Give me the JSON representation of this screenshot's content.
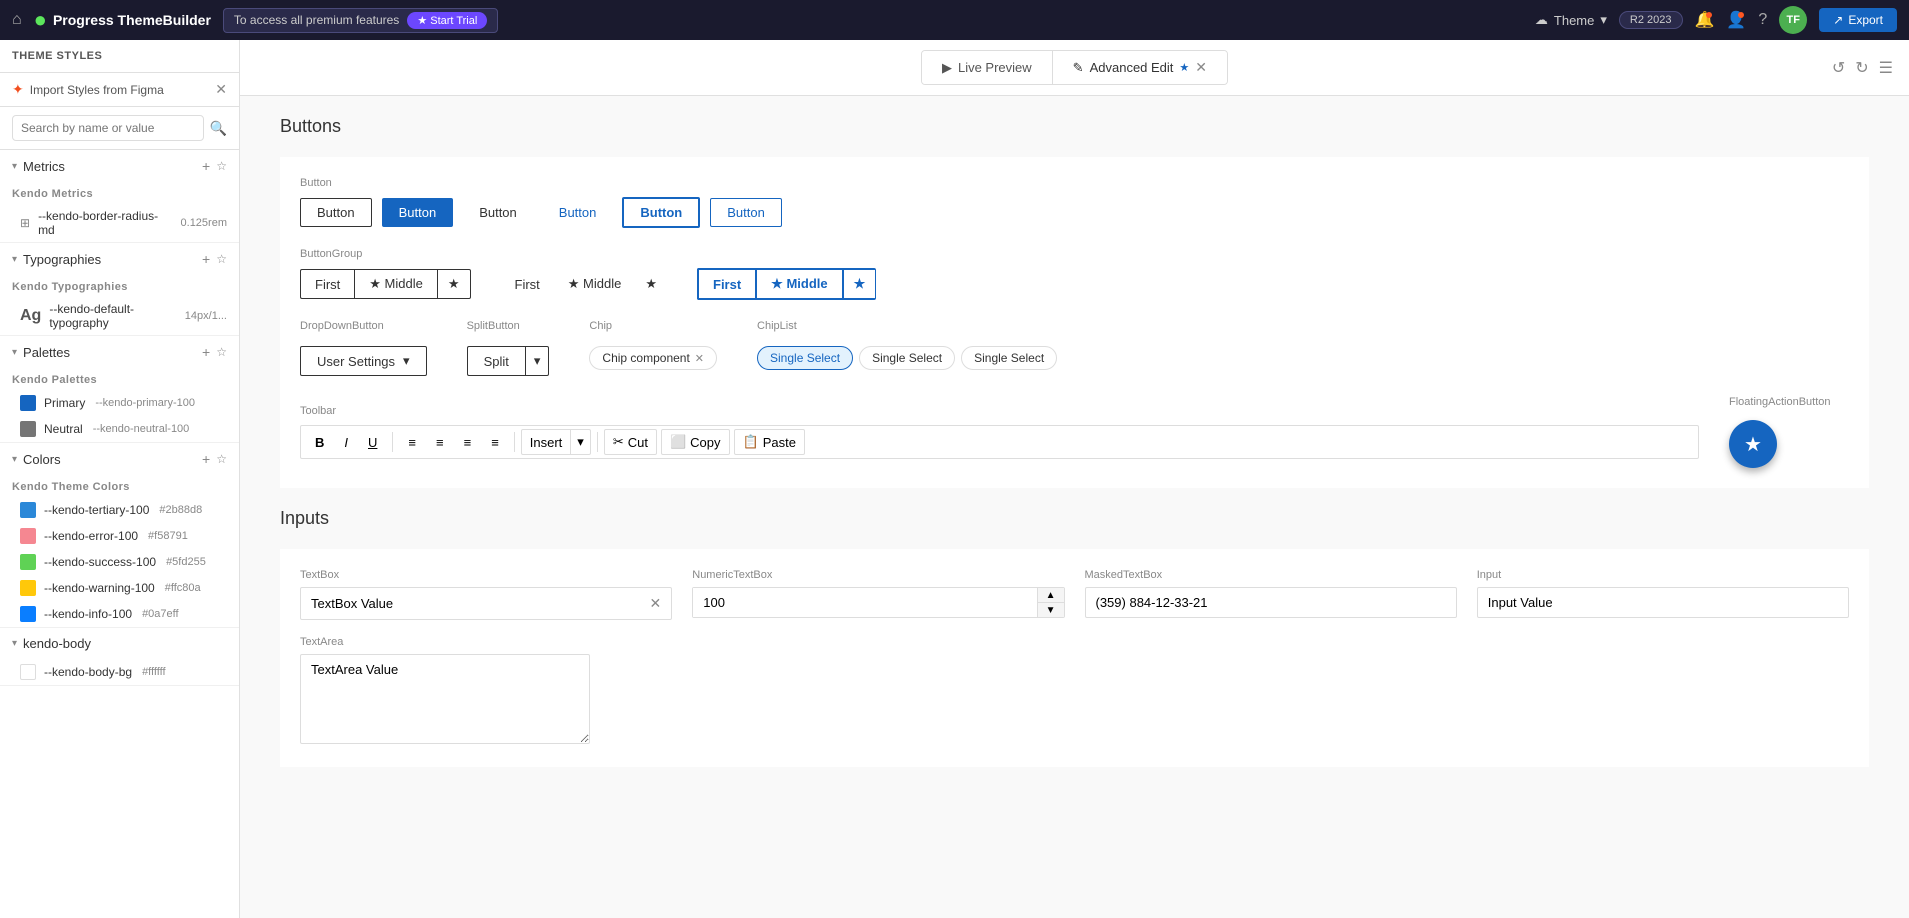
{
  "topnav": {
    "logo_text": "Progress ThemeBuilder",
    "trial_message": "To access all premium features",
    "trial_btn": "★ Start Trial",
    "theme_label": "Theme",
    "version": "R2 2023",
    "export_btn": "Export"
  },
  "toolbar_tabs": {
    "live_preview": "Live Preview",
    "advanced_edit": "Advanced Edit",
    "active": "advanced_edit"
  },
  "sidebar": {
    "header": "THEME STYLES",
    "figma_import": "Import Styles from Figma",
    "search_placeholder": "Search by name or value",
    "sections": [
      {
        "id": "metrics",
        "label": "Metrics",
        "kendo_label": "Kendo Metrics",
        "items": [
          {
            "name": "--kendo-border-radius-md",
            "value": "0.125rem"
          }
        ]
      },
      {
        "id": "typographies",
        "label": "Typographies",
        "kendo_label": "Kendo Typographies",
        "items": [
          {
            "name": "--kendo-default-typography",
            "value": "14px/1..."
          }
        ]
      },
      {
        "id": "palettes",
        "label": "Palettes",
        "kendo_label": "Kendo Palettes",
        "items": [
          {
            "name": "Primary",
            "var": "--kendo-primary-100",
            "color": "#1565C0"
          },
          {
            "name": "Neutral",
            "var": "--kendo-neutral-100",
            "color": "#757575"
          }
        ]
      },
      {
        "id": "colors",
        "label": "Colors",
        "kendo_label": "Kendo Theme Colors",
        "items": [
          {
            "name": "--kendo-tertiary-100",
            "value": "#2b88d8",
            "color": "#2b88d8"
          },
          {
            "name": "--kendo-error-100",
            "value": "#f58791",
            "color": "#f58791"
          },
          {
            "name": "--kendo-success-100",
            "value": "#5fd255",
            "color": "#5fd255"
          },
          {
            "name": "--kendo-warning-100",
            "value": "#ffc80a",
            "color": "#ffc80a"
          },
          {
            "name": "--kendo-info-100",
            "value": "#0a7eff",
            "color": "#0a7eff"
          }
        ]
      },
      {
        "id": "kendo-body",
        "label": "Kendo Body",
        "items": [
          {
            "name": "--kendo-body-bg",
            "value": "#ffffff",
            "color": "#ffffff"
          }
        ]
      }
    ]
  },
  "content": {
    "buttons_section_label": "Buttons",
    "button_label": "Button",
    "buttons": [
      {
        "id": "outline",
        "text": "Button",
        "style": "outline"
      },
      {
        "id": "primary",
        "text": "Button",
        "style": "primary"
      },
      {
        "id": "flat",
        "text": "Button",
        "style": "flat"
      },
      {
        "id": "link",
        "text": "Button",
        "style": "link"
      },
      {
        "id": "outline-primary",
        "text": "Button",
        "style": "outline-primary"
      },
      {
        "id": "outline-light",
        "text": "Button",
        "style": "outline-light"
      }
    ],
    "button_group_label": "ButtonGroup",
    "button_groups": [
      {
        "id": "group1",
        "buttons": [
          "First",
          "Middle",
          "★"
        ],
        "style": "outline"
      },
      {
        "id": "group2",
        "buttons": [
          "First",
          "Middle",
          "★"
        ],
        "style": "flat"
      },
      {
        "id": "group3",
        "buttons": [
          "First",
          "Middle",
          "★"
        ],
        "style": "outline-primary"
      }
    ],
    "dropdown_button_label": "DropDownButton",
    "dropdown_button_text": "User Settings",
    "split_button_label": "SplitButton",
    "split_button_text": "Split",
    "chip_label": "Chip",
    "chip_text": "Chip component",
    "chip_list_label": "ChipList",
    "chip_list_items": [
      "Single Select",
      "Single Select",
      "Single Select"
    ],
    "toolbar_label": "Toolbar",
    "toolbar_buttons": [
      "B",
      "I",
      "U"
    ],
    "toolbar_align_buttons": [
      "≡",
      "≡",
      "≡",
      "≡"
    ],
    "toolbar_insert_text": "Insert",
    "toolbar_cut_text": "Cut",
    "toolbar_copy_text": "Copy",
    "toolbar_paste_text": "Paste",
    "fab_label": "FloatingActionButton",
    "fab_icon": "★",
    "inputs_section_label": "Inputs",
    "textbox_label": "TextBox",
    "textbox_value": "TextBox Value",
    "numeric_label": "NumericTextBox",
    "numeric_value": "100",
    "masked_label": "MaskedTextBox",
    "masked_value": "(359) 884-12-33-21",
    "input_label": "Input",
    "input_value": "Input Value",
    "textarea_label": "TextArea",
    "textarea_value": "TextArea Value"
  }
}
